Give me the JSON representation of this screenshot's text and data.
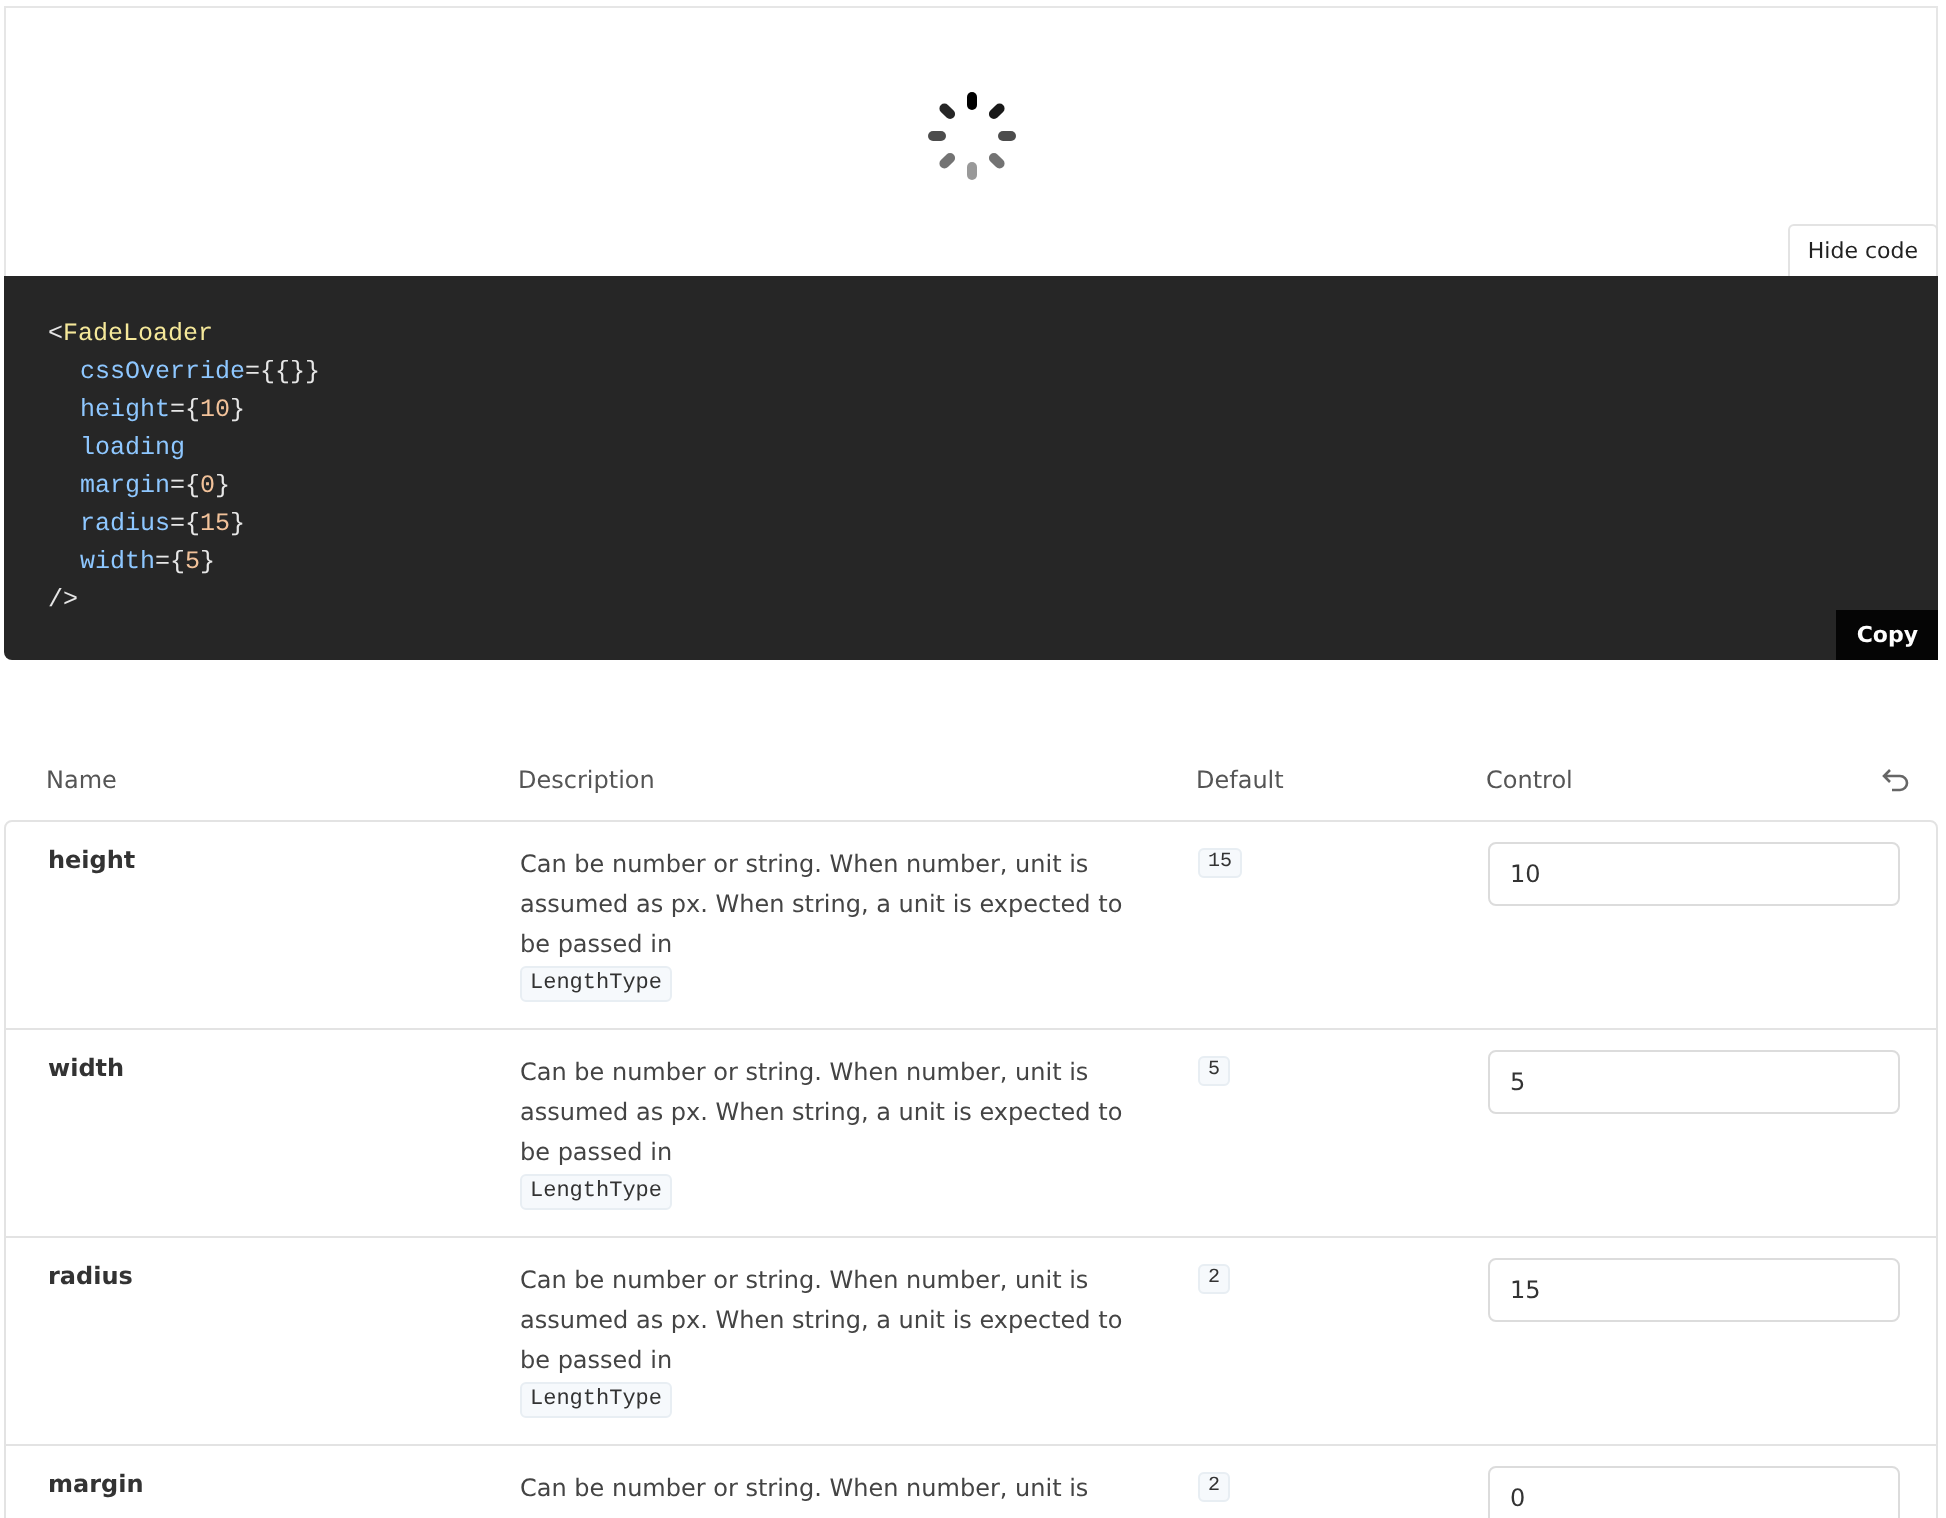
{
  "preview": {
    "toggle_button": "Hide code"
  },
  "code": {
    "lines": [
      [
        {
          "kind": "punct",
          "text": "<"
        },
        {
          "kind": "tag",
          "text": "FadeLoader"
        }
      ],
      [
        {
          "kind": "attr",
          "text": "cssOverride"
        },
        {
          "kind": "punct",
          "text": "={{}}"
        }
      ],
      [
        {
          "kind": "attr",
          "text": "height"
        },
        {
          "kind": "punct",
          "text": "={"
        },
        {
          "kind": "value",
          "text": "10"
        },
        {
          "kind": "punct",
          "text": "}"
        }
      ],
      [
        {
          "kind": "attr",
          "text": "loading"
        }
      ],
      [
        {
          "kind": "attr",
          "text": "margin"
        },
        {
          "kind": "punct",
          "text": "={"
        },
        {
          "kind": "value",
          "text": "0"
        },
        {
          "kind": "punct",
          "text": "}"
        }
      ],
      [
        {
          "kind": "attr",
          "text": "radius"
        },
        {
          "kind": "punct",
          "text": "={"
        },
        {
          "kind": "value",
          "text": "15"
        },
        {
          "kind": "punct",
          "text": "}"
        }
      ],
      [
        {
          "kind": "attr",
          "text": "width"
        },
        {
          "kind": "punct",
          "text": "={"
        },
        {
          "kind": "value",
          "text": "5"
        },
        {
          "kind": "punct",
          "text": "}"
        }
      ],
      [
        {
          "kind": "punct",
          "text": "/>"
        }
      ]
    ],
    "copy_button": "Copy"
  },
  "table": {
    "columns": [
      "Name",
      "Description",
      "Default",
      "Control"
    ],
    "rows": [
      {
        "name": "height",
        "description": "Can be number or string. When number, unit is assumed as px. When string, a unit is expected to be passed in",
        "type": "LengthType",
        "default": "15",
        "value": "10"
      },
      {
        "name": "width",
        "description": "Can be number or string. When number, unit is assumed as px. When string, a unit is expected to be passed in",
        "type": "LengthType",
        "default": "5",
        "value": "5"
      },
      {
        "name": "radius",
        "description": "Can be number or string. When number, unit is assumed as px. When string, a unit is expected to be passed in",
        "type": "LengthType",
        "default": "2",
        "value": "15"
      },
      {
        "name": "margin",
        "description": "Can be number or string. When number, unit is",
        "default": "2",
        "value": "0"
      }
    ]
  }
}
